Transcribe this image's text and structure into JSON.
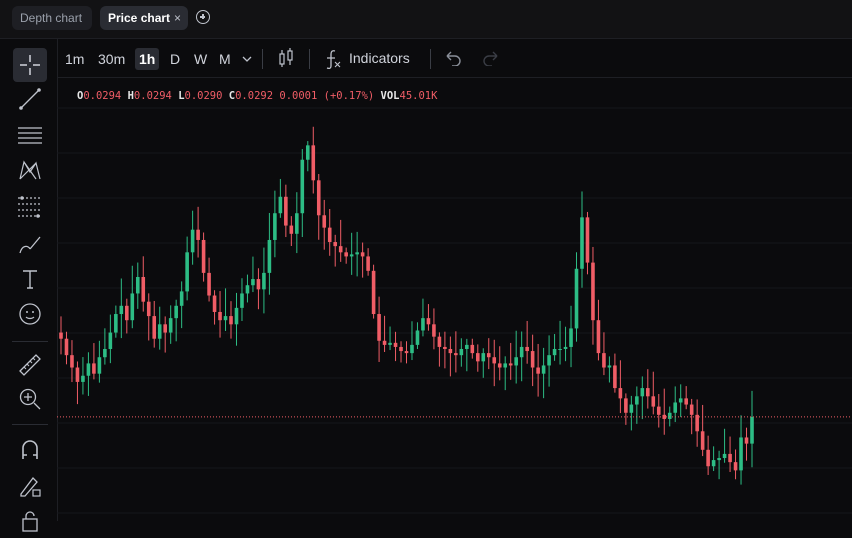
{
  "tabs": [
    {
      "label": "Depth chart"
    },
    {
      "label": "Price chart",
      "close": "×"
    }
  ],
  "toolbar": {
    "timeframes": [
      "1m",
      "30m",
      "1h",
      "D",
      "W",
      "M"
    ],
    "selected_timeframe": "1h",
    "indicators_label": "Indicators"
  },
  "ohlc": {
    "o_label": "O",
    "o": "0.0294",
    "h_label": "H",
    "h": "0.0294",
    "l_label": "L",
    "l": "0.0290",
    "c_label": "C",
    "c": "0.0292",
    "change": "0.0001 (+0.17%)",
    "vol_label": "VOL",
    "vol": "45.01K"
  },
  "left_tools": [
    "crosshair-icon",
    "trend-line-icon",
    "horizontal-lines-icon",
    "pattern-icon",
    "fib-icon",
    "brush-icon",
    "text-icon",
    "emoji-icon",
    "ruler-icon",
    "zoom-in-icon",
    "magnet-icon",
    "lock-draw-icon",
    "lock-icon"
  ],
  "colors": {
    "up": "#2dbd85",
    "down": "#f05d66",
    "bg": "#0b0b0d",
    "grid": "#16171b"
  },
  "chart_data": {
    "type": "candlestick",
    "last_close": 0.0292,
    "closes": [
      0.033,
      0.0322,
      0.0316,
      0.0309,
      0.0312,
      0.0318,
      0.0313,
      0.0321,
      0.0325,
      0.0333,
      0.0342,
      0.0346,
      0.0339,
      0.0352,
      0.036,
      0.0348,
      0.0341,
      0.033,
      0.0337,
      0.0333,
      0.034,
      0.0346,
      0.0353,
      0.0372,
      0.0383,
      0.0378,
      0.0362,
      0.0351,
      0.0343,
      0.0339,
      0.0341,
      0.0337,
      0.0345,
      0.0352,
      0.0356,
      0.0359,
      0.0354,
      0.0362,
      0.0378,
      0.0391,
      0.0399,
      0.0385,
      0.0381,
      0.0391,
      0.0417,
      0.0424,
      0.0407,
      0.039,
      0.0384,
      0.0377,
      0.0375,
      0.0372,
      0.037,
      0.0371,
      0.0372,
      0.037,
      0.0363,
      0.0342,
      0.0329,
      0.0327,
      0.0328,
      0.0326,
      0.0324,
      0.0323,
      0.0327,
      0.0334,
      0.034,
      0.0337,
      0.0331,
      0.0326,
      0.0325,
      0.0323,
      0.0322,
      0.0325,
      0.0327,
      0.0323,
      0.0319,
      0.0323,
      0.0321,
      0.0318,
      0.0316,
      0.0318,
      0.0317,
      0.0321,
      0.0326,
      0.0324,
      0.0316,
      0.0313,
      0.0317,
      0.0322,
      0.0325,
      0.0325,
      0.0326,
      0.0335,
      0.0364,
      0.0389,
      0.0367,
      0.0339,
      0.0323,
      0.0316,
      0.0317,
      0.0306,
      0.0301,
      0.0294,
      0.0298,
      0.0302,
      0.0306,
      0.0302,
      0.0297,
      0.0293,
      0.0291,
      0.0294,
      0.0299,
      0.0301,
      0.0298,
      0.0293,
      0.0285,
      0.0276,
      0.0268,
      0.0271,
      0.0272,
      0.0274,
      0.027,
      0.0266,
      0.0282,
      0.0279,
      0.0292
    ]
  }
}
